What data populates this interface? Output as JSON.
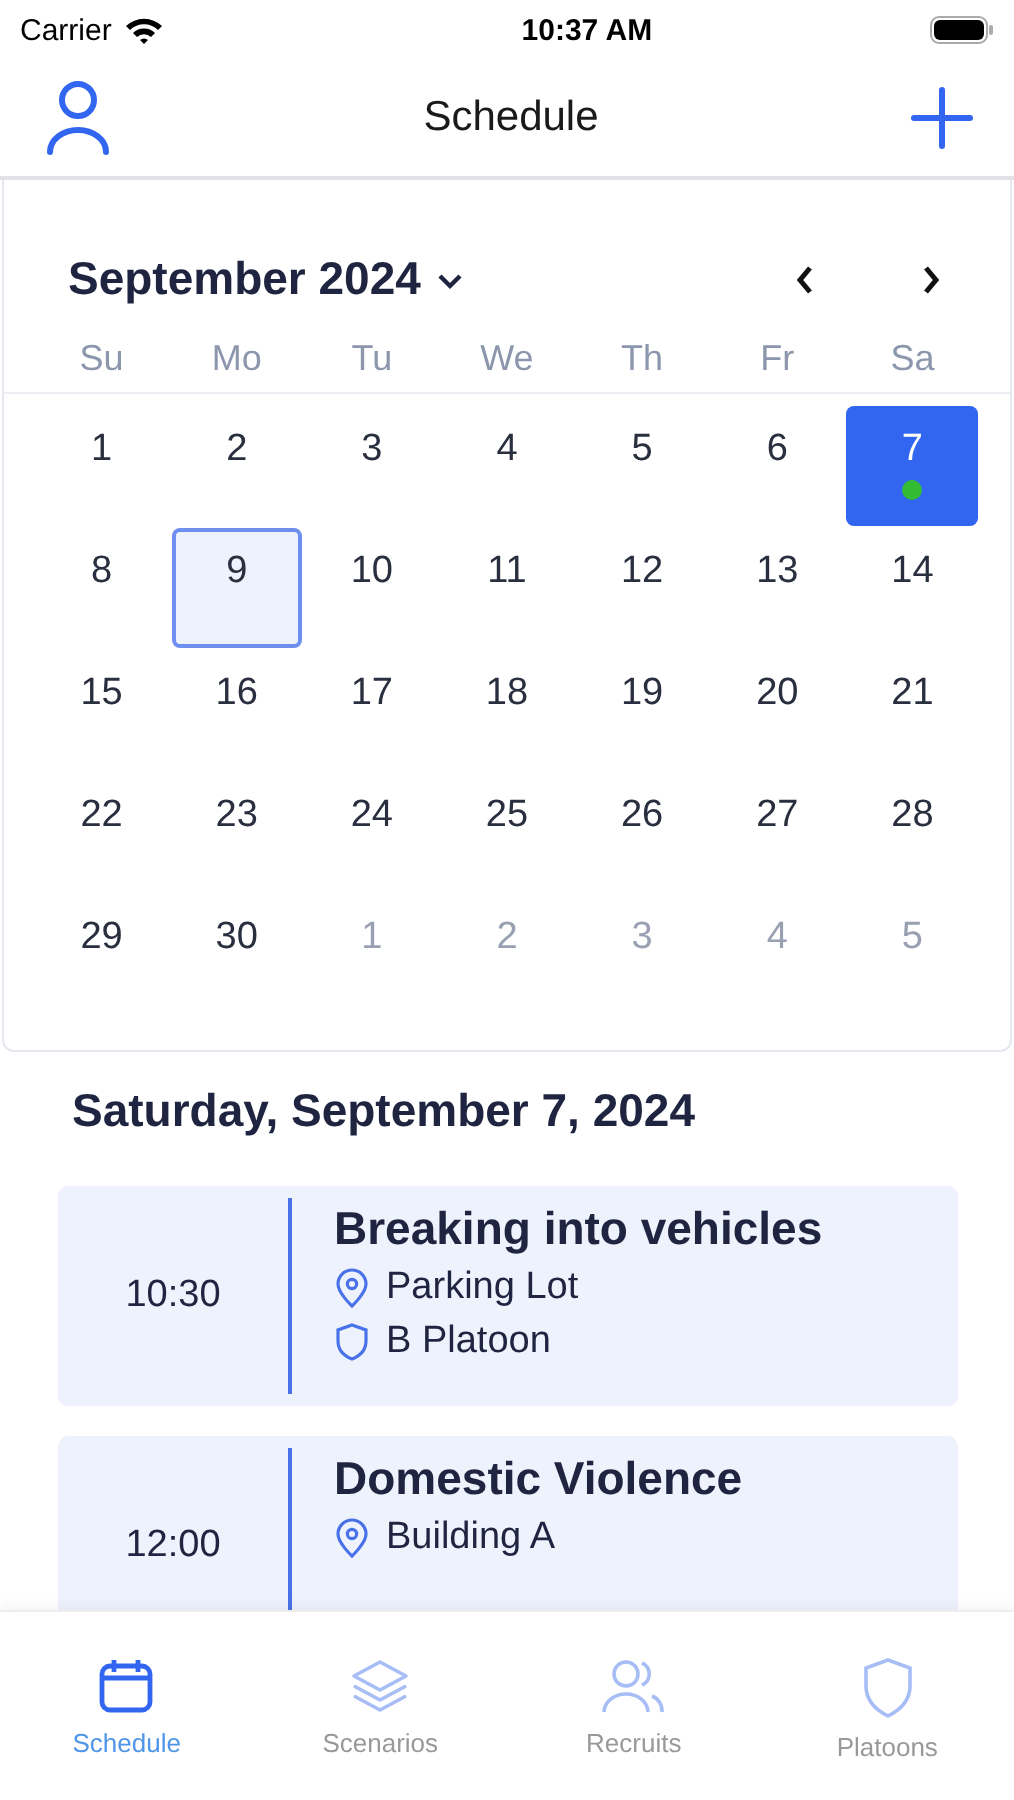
{
  "status_bar": {
    "carrier": "Carrier",
    "time": "10:37 AM"
  },
  "nav": {
    "title": "Schedule"
  },
  "calendar": {
    "month": "September 2024",
    "weekdays": [
      "Su",
      "Mo",
      "Tu",
      "We",
      "Th",
      "Fr",
      "Sa"
    ],
    "weeks": [
      [
        {
          "label": "1",
          "outside": false,
          "selected": false,
          "today": false,
          "event": false
        },
        {
          "label": "2",
          "outside": false,
          "selected": false,
          "today": false,
          "event": false
        },
        {
          "label": "3",
          "outside": false,
          "selected": false,
          "today": false,
          "event": false
        },
        {
          "label": "4",
          "outside": false,
          "selected": false,
          "today": false,
          "event": false
        },
        {
          "label": "5",
          "outside": false,
          "selected": false,
          "today": false,
          "event": false
        },
        {
          "label": "6",
          "outside": false,
          "selected": false,
          "today": false,
          "event": false
        },
        {
          "label": "7",
          "outside": false,
          "selected": true,
          "today": false,
          "event": true
        }
      ],
      [
        {
          "label": "8",
          "outside": false,
          "selected": false,
          "today": false,
          "event": false
        },
        {
          "label": "9",
          "outside": false,
          "selected": false,
          "today": true,
          "event": false
        },
        {
          "label": "10",
          "outside": false,
          "selected": false,
          "today": false,
          "event": false
        },
        {
          "label": "11",
          "outside": false,
          "selected": false,
          "today": false,
          "event": false
        },
        {
          "label": "12",
          "outside": false,
          "selected": false,
          "today": false,
          "event": false
        },
        {
          "label": "13",
          "outside": false,
          "selected": false,
          "today": false,
          "event": false
        },
        {
          "label": "14",
          "outside": false,
          "selected": false,
          "today": false,
          "event": false
        }
      ],
      [
        {
          "label": "15",
          "outside": false,
          "selected": false,
          "today": false,
          "event": false
        },
        {
          "label": "16",
          "outside": false,
          "selected": false,
          "today": false,
          "event": false
        },
        {
          "label": "17",
          "outside": false,
          "selected": false,
          "today": false,
          "event": false
        },
        {
          "label": "18",
          "outside": false,
          "selected": false,
          "today": false,
          "event": false
        },
        {
          "label": "19",
          "outside": false,
          "selected": false,
          "today": false,
          "event": false
        },
        {
          "label": "20",
          "outside": false,
          "selected": false,
          "today": false,
          "event": false
        },
        {
          "label": "21",
          "outside": false,
          "selected": false,
          "today": false,
          "event": false
        }
      ],
      [
        {
          "label": "22",
          "outside": false,
          "selected": false,
          "today": false,
          "event": false
        },
        {
          "label": "23",
          "outside": false,
          "selected": false,
          "today": false,
          "event": false
        },
        {
          "label": "24",
          "outside": false,
          "selected": false,
          "today": false,
          "event": false
        },
        {
          "label": "25",
          "outside": false,
          "selected": false,
          "today": false,
          "event": false
        },
        {
          "label": "26",
          "outside": false,
          "selected": false,
          "today": false,
          "event": false
        },
        {
          "label": "27",
          "outside": false,
          "selected": false,
          "today": false,
          "event": false
        },
        {
          "label": "28",
          "outside": false,
          "selected": false,
          "today": false,
          "event": false
        }
      ],
      [
        {
          "label": "29",
          "outside": false,
          "selected": false,
          "today": false,
          "event": false
        },
        {
          "label": "30",
          "outside": false,
          "selected": false,
          "today": false,
          "event": false
        },
        {
          "label": "1",
          "outside": true,
          "selected": false,
          "today": false,
          "event": false
        },
        {
          "label": "2",
          "outside": true,
          "selected": false,
          "today": false,
          "event": false
        },
        {
          "label": "3",
          "outside": true,
          "selected": false,
          "today": false,
          "event": false
        },
        {
          "label": "4",
          "outside": true,
          "selected": false,
          "today": false,
          "event": false
        },
        {
          "label": "5",
          "outside": true,
          "selected": false,
          "today": false,
          "event": false
        }
      ]
    ]
  },
  "day_heading": "Saturday, September 7, 2024",
  "sessions": [
    {
      "time": "10:30",
      "title": "Breaking into vehicles",
      "location": "Parking Lot",
      "platoon": "B Platoon"
    },
    {
      "time": "12:00",
      "title": "Domestic Violence",
      "location": "Building A"
    }
  ],
  "tabs": [
    {
      "label": "Schedule",
      "selected": true
    },
    {
      "label": "Scenarios",
      "selected": false
    },
    {
      "label": "Recruits",
      "selected": false
    },
    {
      "label": "Platoons",
      "selected": false
    }
  ]
}
